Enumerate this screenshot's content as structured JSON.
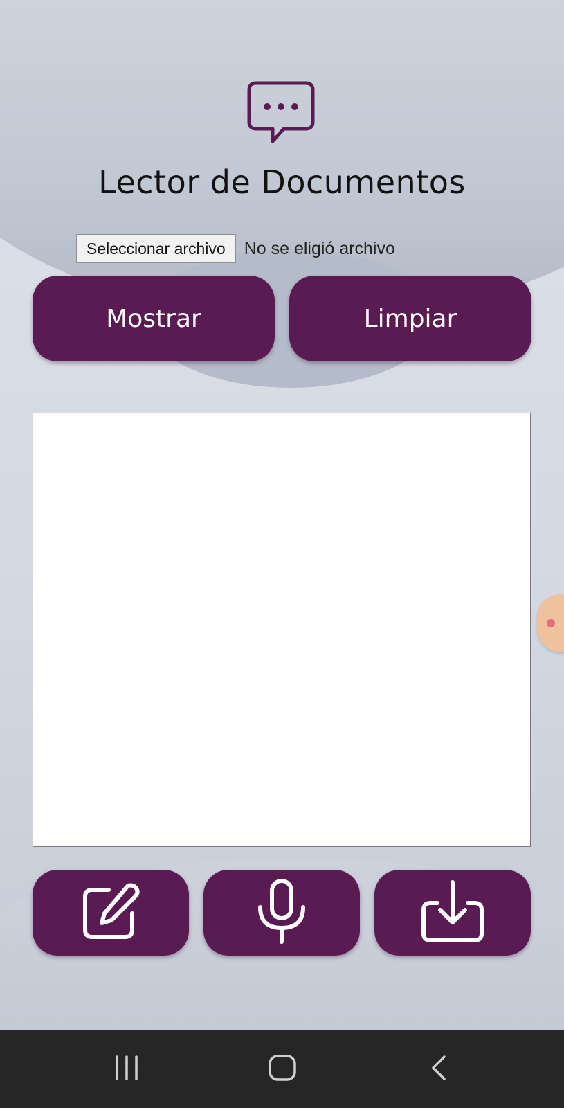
{
  "app": {
    "title": "Lector de Documentos",
    "icon": "chat-bubble-dots-icon"
  },
  "file_input": {
    "button_label": "Seleccionar archivo",
    "status": "No se eligió archivo"
  },
  "actions": {
    "show_label": "Mostrar",
    "clear_label": "Limpiar"
  },
  "text_area": {
    "value": "",
    "placeholder": ""
  },
  "tools": [
    {
      "icon": "edit-icon"
    },
    {
      "icon": "microphone-icon"
    },
    {
      "icon": "download-icon"
    }
  ],
  "nav_bar": {
    "items": [
      "recents-icon",
      "home-icon",
      "back-icon"
    ]
  },
  "colors": {
    "accent": "#5a1a52",
    "background": "#dde2ea",
    "nav_bar": "#262626"
  }
}
